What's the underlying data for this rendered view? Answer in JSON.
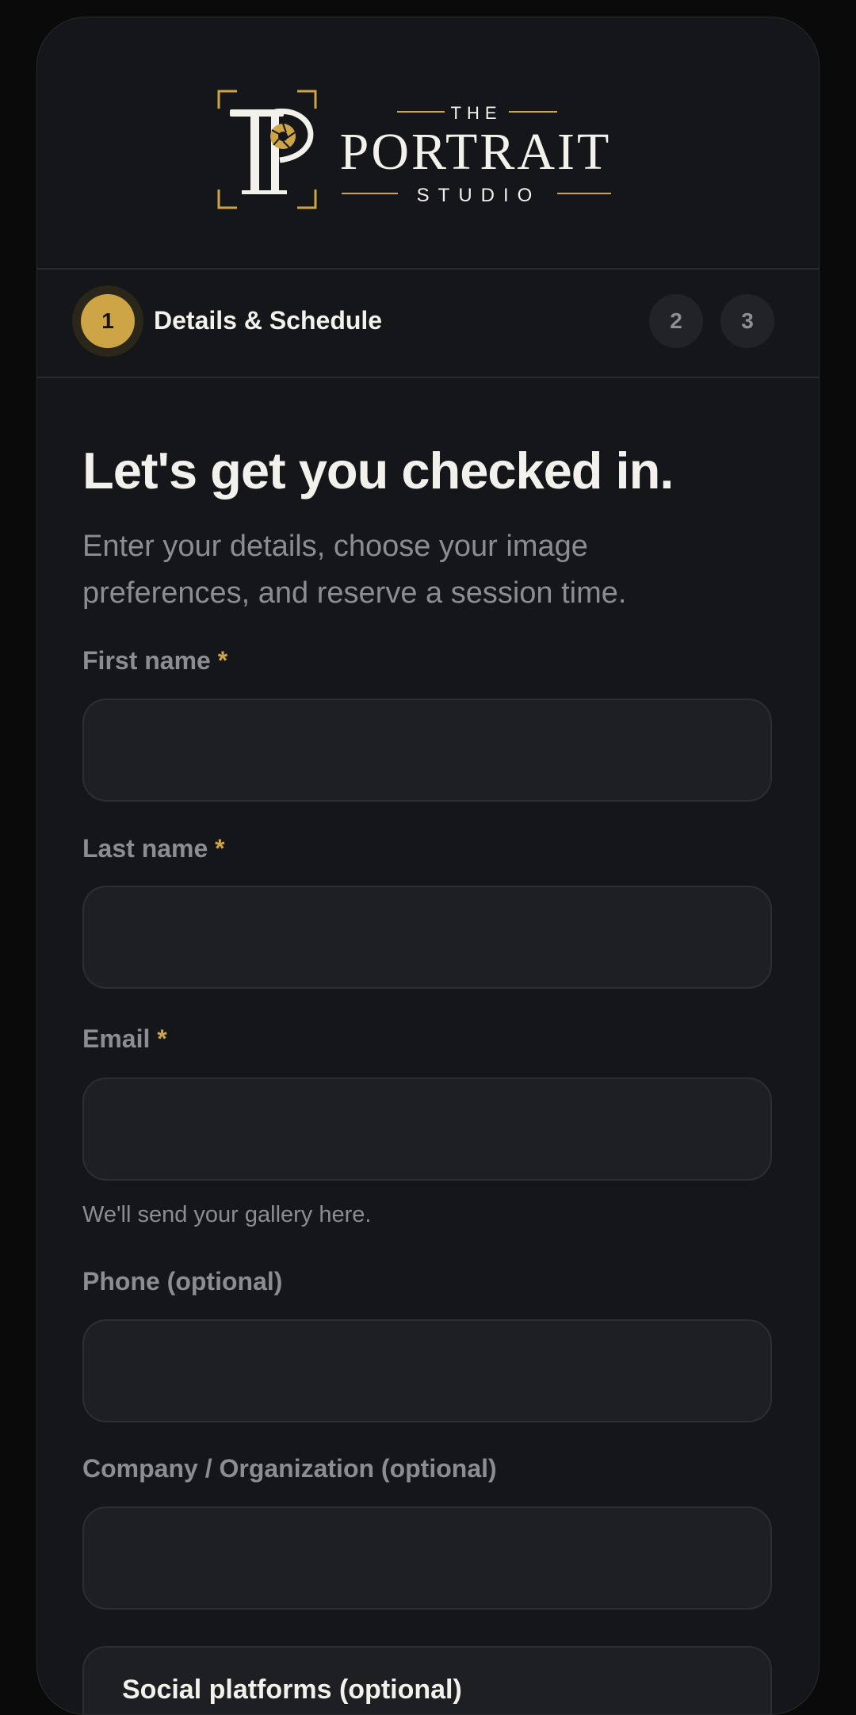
{
  "brand": {
    "monogram": "TP",
    "top_word": "THE",
    "main_word": "PORTRAIT",
    "bottom_word": "STUDIO",
    "gold": "#cda546",
    "cream": "#f3f1ec"
  },
  "stepper": {
    "active_number": "1",
    "active_label": "Details & Schedule",
    "step2": "2",
    "step3": "3"
  },
  "heading": {
    "title": "Let's get you checked in.",
    "subtitle": "Enter your details, choose your image preferences, and reserve a session time."
  },
  "form": {
    "first_name": {
      "label": "First name",
      "required": "*",
      "value": ""
    },
    "last_name": {
      "label": "Last name",
      "required": "*",
      "value": ""
    },
    "email": {
      "label": "Email",
      "required": "*",
      "value": "",
      "helper": "We'll send your gallery here."
    },
    "phone": {
      "label": "Phone (optional)",
      "value": ""
    },
    "company": {
      "label": "Company / Organization (optional)",
      "value": ""
    },
    "social": {
      "label": "Social platforms (optional)"
    }
  },
  "colors": {
    "page_bg": "#0a0a0b",
    "card_bg": "#151619",
    "input_bg": "#1e1f23",
    "accent": "#cda546",
    "muted_text": "#8b8d93"
  }
}
